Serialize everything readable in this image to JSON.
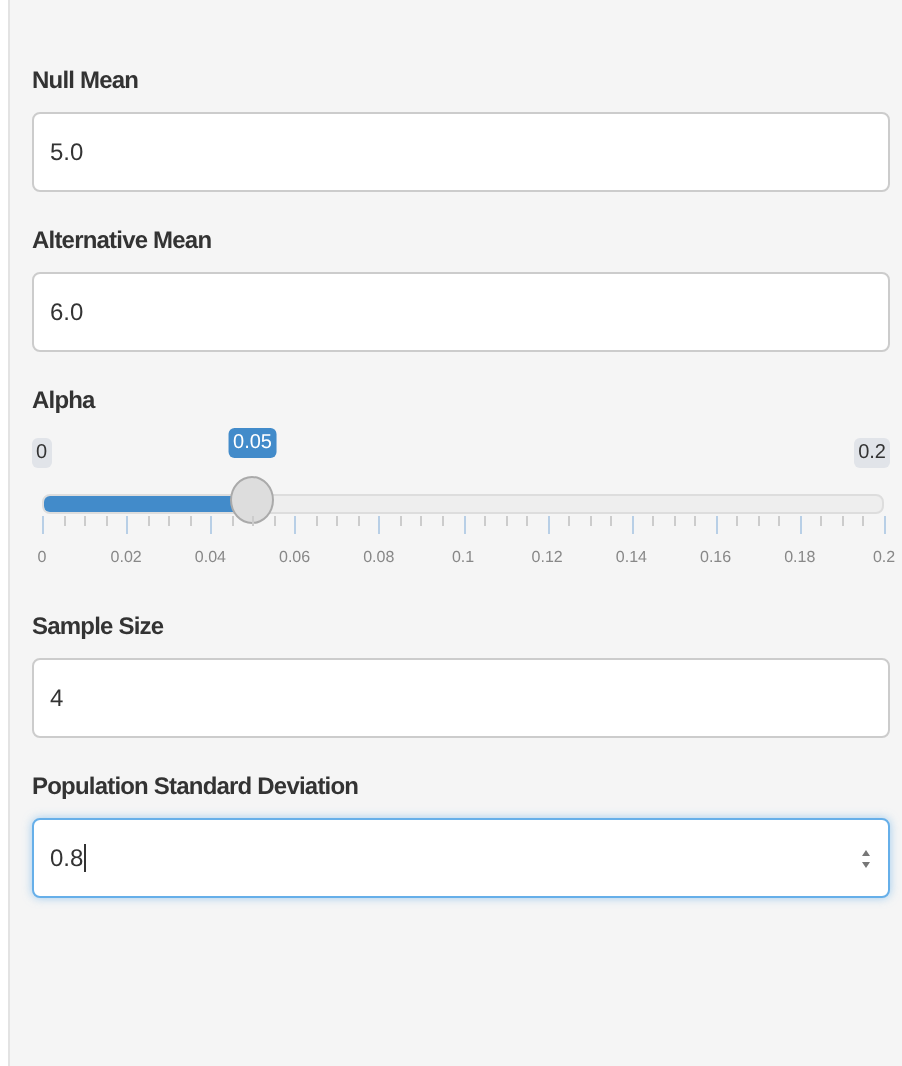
{
  "fields": [
    {
      "kind": "text",
      "label": "Null Mean",
      "value": "5.0",
      "focused": false
    },
    {
      "kind": "text",
      "label": "Alternative Mean",
      "value": "6.0",
      "focused": false
    },
    {
      "kind": "slider",
      "label": "Alpha",
      "min_label": "0",
      "max_label": "0.2",
      "value_label": "0.05",
      "level": 0.25,
      "ticks": [
        "0",
        "0.02",
        "0.04",
        "0.06",
        "0.08",
        "0.1",
        "0.12",
        "0.14",
        "0.16",
        "0.18",
        "0.2"
      ]
    },
    {
      "kind": "text",
      "label": "Sample Size",
      "value": "4",
      "focused": false
    },
    {
      "kind": "number",
      "label": "Population Standard Deviation",
      "value": "0.8",
      "focused": true
    }
  ]
}
